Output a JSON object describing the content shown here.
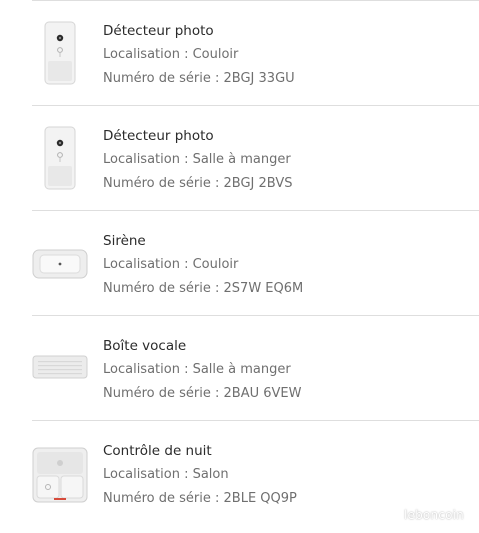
{
  "devices": [
    {
      "name": "Détecteur photo",
      "location_label": "Localisation : Couloir",
      "serial_label": "Numéro de série : 2BGJ 33GU",
      "icon": "photo-detector-icon"
    },
    {
      "name": "Détecteur photo",
      "location_label": "Localisation : Salle à manger",
      "serial_label": "Numéro de série : 2BGJ 2BVS",
      "icon": "photo-detector-icon"
    },
    {
      "name": "Sirène",
      "location_label": "Localisation : Couloir",
      "serial_label": "Numéro de série : 2S7W EQ6M",
      "icon": "siren-icon"
    },
    {
      "name": "Boîte vocale",
      "location_label": "Localisation : Salle à manger",
      "serial_label": "Numéro de série : 2BAU 6VEW",
      "icon": "voice-box-icon"
    },
    {
      "name": "Contrôle de nuit",
      "location_label": "Localisation : Salon",
      "serial_label": "Numéro de série : 2BLE QQ9P",
      "icon": "night-control-icon"
    }
  ],
  "watermark": "leboncoin"
}
